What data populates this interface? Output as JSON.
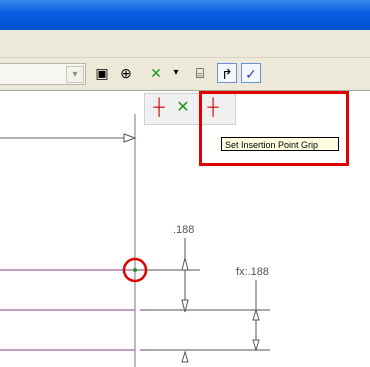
{
  "mini_toolbar": {
    "tooltip": "Set Insertion Point Grip"
  },
  "canvas": {
    "dimension_top": ".188",
    "dimension_right": "fx:.188"
  },
  "icons": {
    "combo_dropdown": "chevron-down-icon",
    "tb1": "property-icon",
    "tb2": "sketch-icon",
    "tb3": "center-point-icon",
    "tb4": "dimension-icon",
    "tb5": "insertion-point-icon",
    "tb6": "check-icon"
  },
  "colors": {
    "highlight": "#e00000",
    "accent": "#0352d2",
    "geometry": "#8a3c92"
  }
}
